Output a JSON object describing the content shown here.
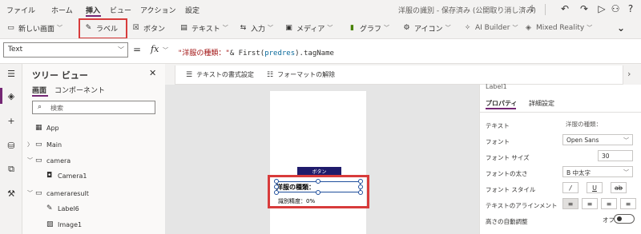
{
  "menu": {
    "items": [
      "ファイル",
      "ホーム",
      "挿入",
      "ビュー",
      "アクション",
      "設定"
    ],
    "active_index": 2
  },
  "app_title": "洋服の識別 - 保存済み (公開取り消し済み)",
  "top_icons": [
    "stethoscope-icon",
    "undo-icon",
    "redo-icon",
    "play-icon",
    "user-icon",
    "help-icon"
  ],
  "toolbar": {
    "new_screen": "新しい画面",
    "label": "ラベル",
    "button": "ボタン",
    "text": "テキスト",
    "input": "入力",
    "media": "メディア",
    "chart": "グラフ",
    "icons": "アイコン",
    "ai_builder": "AI Builder",
    "mixed_reality": "Mixed Reality"
  },
  "formula": {
    "property": "Text",
    "equals": "=",
    "fx": "fx",
    "string_part": "\"洋服の種類：\"",
    "rest_part": "& First(",
    "identifier": "predres",
    "tail": ").tagName",
    "format_text": "テキストの書式設定",
    "remove_format": "フォーマットの解除"
  },
  "tree": {
    "title": "ツリー ビュー",
    "tabs": [
      "画面",
      "コンポーネント"
    ],
    "search_placeholder": "検索",
    "nodes": [
      {
        "label": "App",
        "icon": "app-icon",
        "expandable": false,
        "depth": 0
      },
      {
        "label": "Main",
        "icon": "screen-icon",
        "expandable": true,
        "depth": 0
      },
      {
        "label": "camera",
        "icon": "screen-icon",
        "expandable": true,
        "depth": 0
      },
      {
        "label": "Camera1",
        "icon": "camera-icon",
        "expandable": false,
        "depth": 1
      },
      {
        "label": "cameraresult",
        "icon": "screen-icon",
        "expandable": true,
        "depth": 0
      },
      {
        "label": "Label6",
        "icon": "label-icon",
        "expandable": false,
        "depth": 1
      },
      {
        "label": "Image1",
        "icon": "image-icon",
        "expandable": false,
        "depth": 1
      }
    ]
  },
  "canvas": {
    "button_text": "ボタン",
    "label_kind": "洋服の種類：",
    "label_accuracy": "識別精度：0%"
  },
  "properties": {
    "control_name": "Label1",
    "tabs": [
      "プロパティ",
      "詳細設定"
    ],
    "rows": {
      "text_label": "テキスト",
      "text_value": "洋服の種類：",
      "font_label": "フォント",
      "font_value": "Open Sans",
      "font_size_label": "フォント サイズ",
      "font_size_value": "30",
      "font_weight_label": "フォントの太さ",
      "font_weight_value": "B  中太字",
      "font_style_label": "フォント スタイル",
      "align_label": "テキストのアラインメント",
      "autoheight_label": "高さの自動調整",
      "autoheight_value": "オフ"
    }
  },
  "colors": {
    "accent": "#742774",
    "highlight_red": "#d83b3b",
    "button_navy": "#1f1b6b"
  }
}
